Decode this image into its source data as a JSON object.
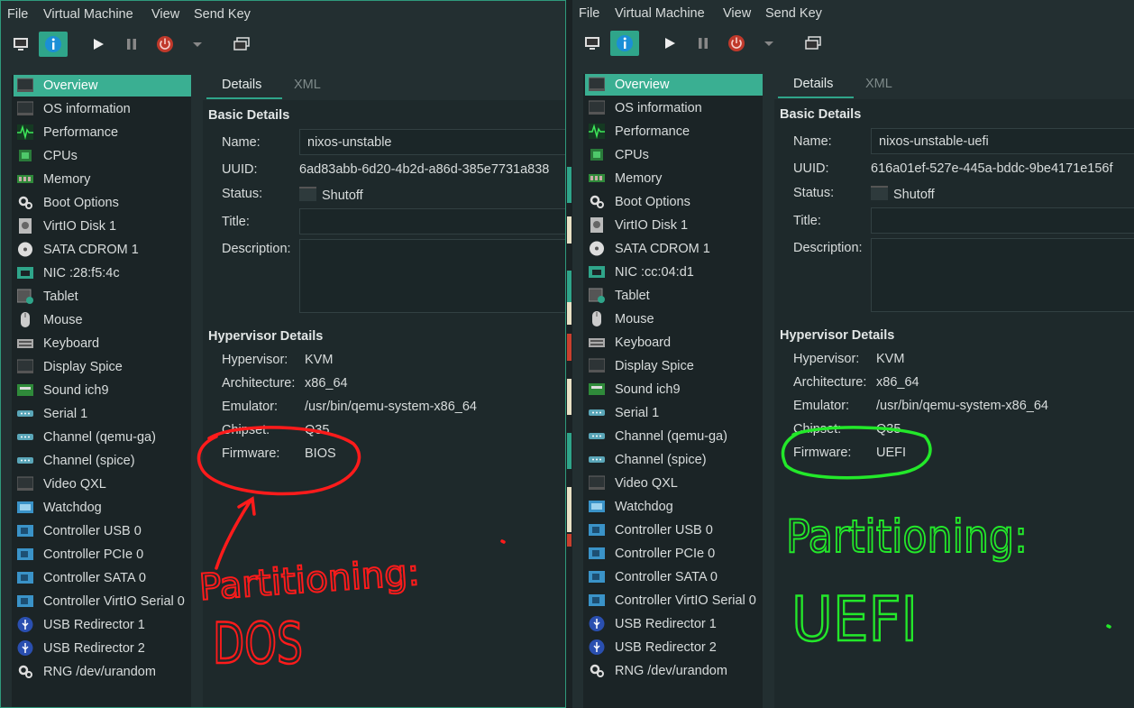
{
  "colors": {
    "accent": "#3aaf92",
    "window_bg": "#232f31",
    "annotation_left": "#ff1b1b",
    "annotation_right": "#23e82a"
  },
  "menu": [
    "File",
    "Virtual Machine",
    "View",
    "Send Key"
  ],
  "toolbar_icons": [
    "console-icon",
    "info-icon",
    "run-icon",
    "pause-icon",
    "shutdown-icon",
    "shutdown-menu-icon",
    "snapshots-icon"
  ],
  "tabs": {
    "details": "Details",
    "xml": "XML"
  },
  "sidebar": [
    {
      "label": "Overview",
      "icon": "monitor-icon"
    },
    {
      "label": "OS information",
      "icon": "os-icon"
    },
    {
      "label": "Performance",
      "icon": "performance-icon"
    },
    {
      "label": "CPUs",
      "icon": "cpu-icon"
    },
    {
      "label": "Memory",
      "icon": "memory-icon"
    },
    {
      "label": "Boot Options",
      "icon": "gear-icon"
    },
    {
      "label": "VirtIO Disk 1",
      "icon": "disk-icon"
    },
    {
      "label": "SATA CDROM 1",
      "icon": "cdrom-icon"
    },
    {
      "label": "NIC",
      "icon": "nic-icon"
    },
    {
      "label": "Tablet",
      "icon": "tablet-icon"
    },
    {
      "label": "Mouse",
      "icon": "mouse-icon"
    },
    {
      "label": "Keyboard",
      "icon": "keyboard-icon"
    },
    {
      "label": "Display Spice",
      "icon": "display-icon"
    },
    {
      "label": "Sound ich9",
      "icon": "sound-icon"
    },
    {
      "label": "Serial 1",
      "icon": "serial-icon"
    },
    {
      "label": "Channel (qemu-ga)",
      "icon": "channel-icon"
    },
    {
      "label": "Channel (spice)",
      "icon": "channel-icon"
    },
    {
      "label": "Video QXL",
      "icon": "video-icon"
    },
    {
      "label": "Watchdog",
      "icon": "watchdog-icon"
    },
    {
      "label": "Controller USB 0",
      "icon": "controller-icon"
    },
    {
      "label": "Controller PCIe 0",
      "icon": "controller-icon"
    },
    {
      "label": "Controller SATA 0",
      "icon": "controller-icon"
    },
    {
      "label": "Controller VirtIO Serial 0",
      "icon": "controller-icon"
    },
    {
      "label": "USB Redirector 1",
      "icon": "usb-icon"
    },
    {
      "label": "USB Redirector 2",
      "icon": "usb-icon"
    },
    {
      "label": "RNG /dev/urandom",
      "icon": "gear-icon"
    }
  ],
  "labels": {
    "basic_details": "Basic Details",
    "name": "Name:",
    "uuid": "UUID:",
    "status": "Status:",
    "title": "Title:",
    "description": "Description:",
    "hypervisor_details": "Hypervisor Details",
    "hypervisor": "Hypervisor:",
    "architecture": "Architecture:",
    "emulator": "Emulator:",
    "chipset": "Chipset:",
    "firmware": "Firmware:"
  },
  "windows": [
    {
      "nic_label": "NIC :28:f5:4c",
      "name": "nixos-unstable",
      "uuid": "6ad83abb-6d20-4b2d-a86d-385e7731a838",
      "status": "Shutoff",
      "hypervisor": "KVM",
      "architecture": "x86_64",
      "emulator": "/usr/bin/qemu-system-x86_64",
      "chipset": "Q35",
      "firmware": "BIOS",
      "annotation_line1": "Partitioning:",
      "annotation_line2": "DOS"
    },
    {
      "nic_label": "NIC :cc:04:d1",
      "name": "nixos-unstable-uefi",
      "uuid": "616a01ef-527e-445a-bddc-9be4171e156f",
      "status": "Shutoff",
      "hypervisor": "KVM",
      "architecture": "x86_64",
      "emulator": "/usr/bin/qemu-system-x86_64",
      "chipset": "Q35",
      "firmware": "UEFI",
      "annotation_line1": "Partitioning:",
      "annotation_line2": "UEFI"
    }
  ]
}
